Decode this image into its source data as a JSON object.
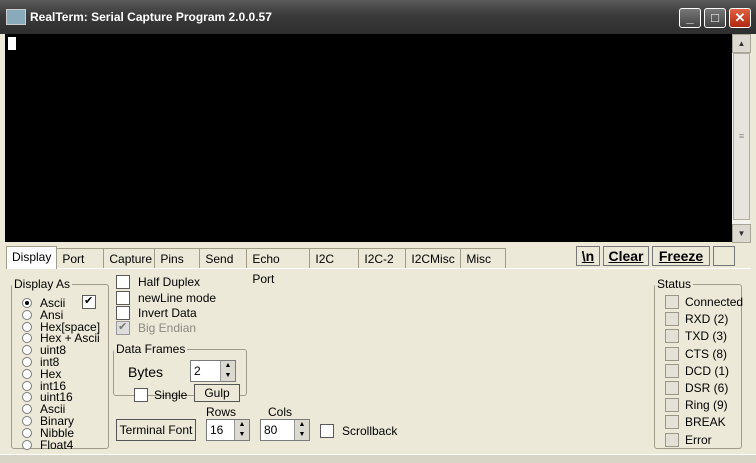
{
  "window": {
    "title": "RealTerm: Serial Capture Program 2.0.0.57",
    "min": "_",
    "max": "□",
    "close": "✕"
  },
  "tabs": [
    "Display",
    "Port",
    "Capture",
    "Pins",
    "Send",
    "Echo Port",
    "I2C",
    "I2C-2",
    "I2CMisc",
    "Misc"
  ],
  "toolbar": {
    "newline": "\\n",
    "clear": "Clear",
    "freeze": "Freeze"
  },
  "display_as": {
    "legend": "Display As",
    "options": [
      "Ascii",
      "Ansi",
      "Hex[space]",
      "Hex + Ascii",
      "uint8",
      "int8",
      "Hex",
      "int16",
      "uint16",
      "Ascii",
      "Binary",
      "Nibble",
      "Float4"
    ],
    "selected": 0
  },
  "options": {
    "half_duplex": "Half Duplex",
    "newline_mode": "newLine mode",
    "invert_data": "Invert Data",
    "big_endian": "Big Endian"
  },
  "data_frames": {
    "legend": "Data Frames",
    "bytes_label": "Bytes",
    "bytes_value": "2",
    "single": "Single",
    "gulp": "Gulp"
  },
  "terminal": {
    "font_button": "Terminal Font",
    "rows_label": "Rows",
    "rows_value": "16",
    "cols_label": "Cols",
    "cols_value": "80",
    "scrollback": "Scrollback"
  },
  "status": {
    "legend": "Status",
    "items": [
      "Connected",
      "RXD (2)",
      "TXD (3)",
      "CTS (8)",
      "DCD (1)",
      "DSR (6)",
      "Ring (9)",
      "BREAK",
      "Error"
    ]
  }
}
